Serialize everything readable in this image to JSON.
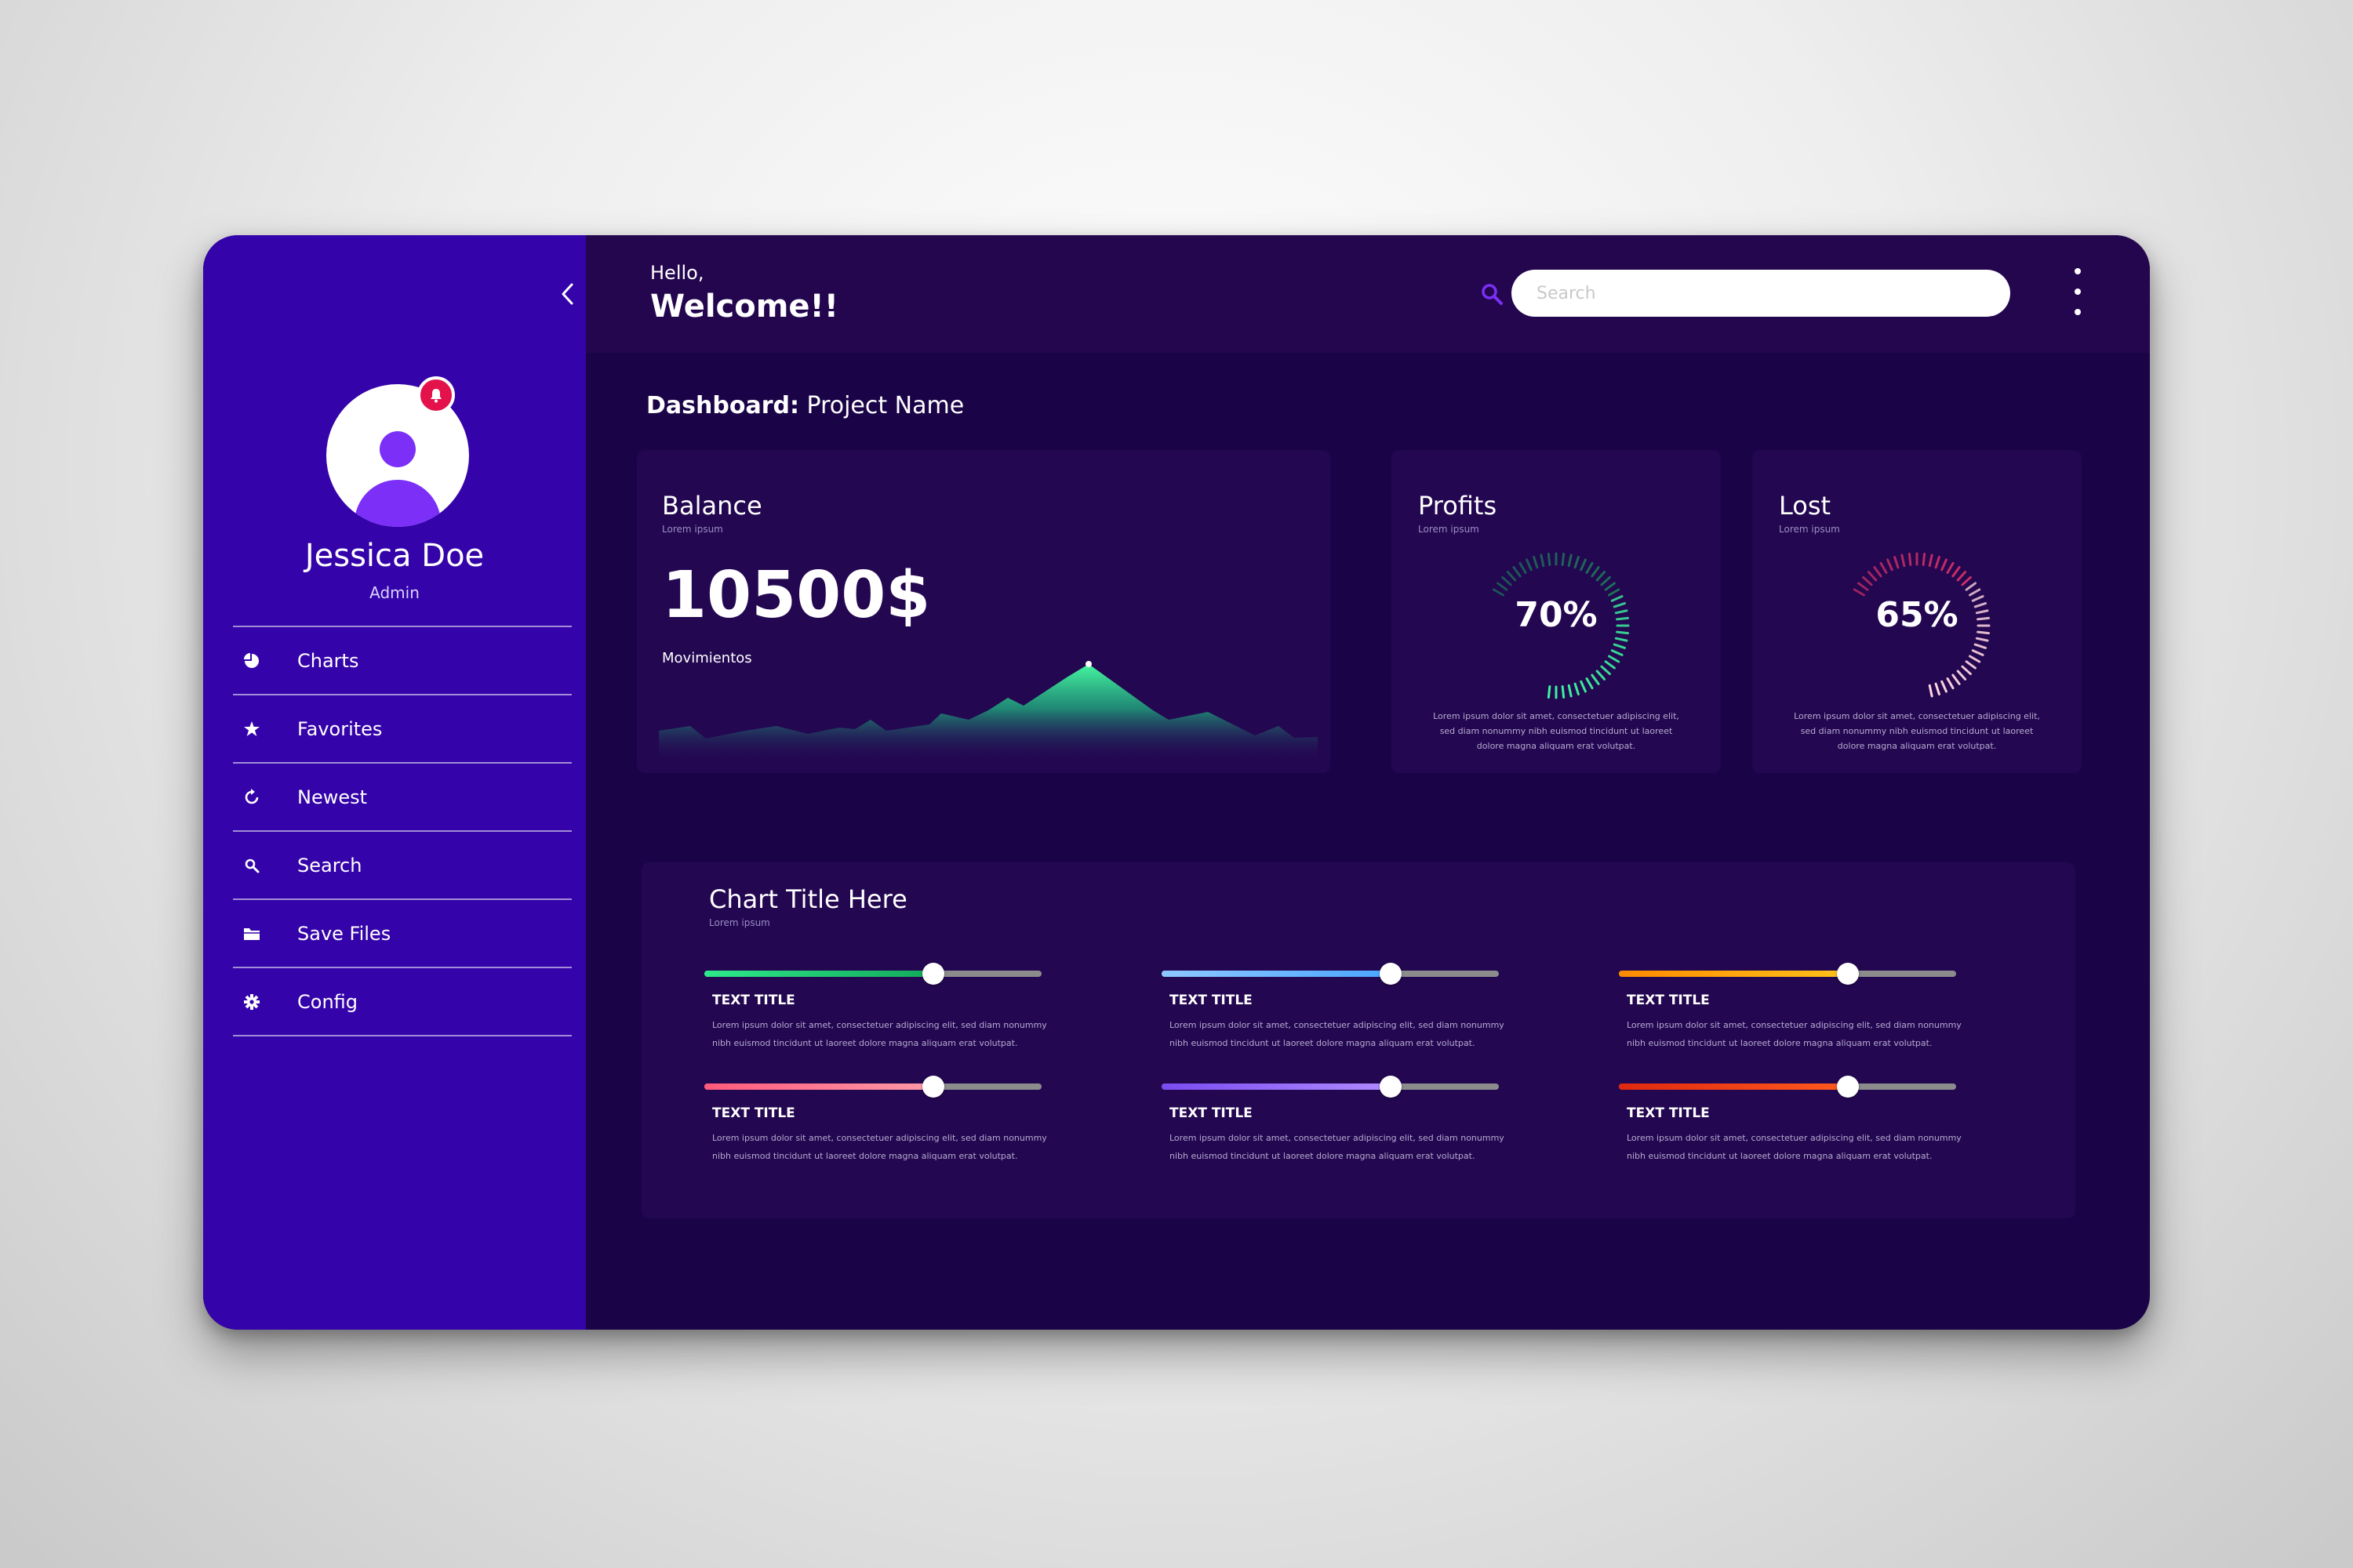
{
  "sidebar": {
    "user": {
      "name": "Jessica Doe",
      "role": "Admin"
    },
    "items": [
      {
        "label": "Charts",
        "icon": "pie-chart-icon"
      },
      {
        "label": "Favorites",
        "icon": "star-icon"
      },
      {
        "label": "Newest",
        "icon": "refresh-icon"
      },
      {
        "label": "Search",
        "icon": "search-icon"
      },
      {
        "label": "Save Files",
        "icon": "folder-icon"
      },
      {
        "label": "Config",
        "icon": "gear-icon"
      }
    ]
  },
  "header": {
    "hello": "Hello,",
    "welcome": "Welcome!!",
    "search_placeholder": "Search"
  },
  "main": {
    "title_bold": "Dashboard:",
    "title_rest": " Project Name",
    "balance": {
      "title": "Balance",
      "subtitle": "Lorem ipsum",
      "value": "10500$",
      "chart_label": "Movimientos"
    },
    "profits": {
      "title": "Profits",
      "subtitle": "Lorem ipsum",
      "value": "70%",
      "percent": 70,
      "text": "Lorem ipsum dolor sit amet, consectetuer adipiscing elit, sed diam nonummy nibh euismod tincidunt ut laoreet dolore magna aliquam erat volutpat."
    },
    "lost": {
      "title": "Lost",
      "subtitle": "Lorem ipsum",
      "value": "65%",
      "percent": 65,
      "text": "Lorem ipsum dolor sit amet, consectetuer adipiscing elit, sed diam nonummy nibh euismod tincidunt ut laoreet dolore magna aliquam erat volutpat."
    },
    "chart_section": {
      "title": "Chart Title Here",
      "subtitle": "Lorem ipsum",
      "items": [
        {
          "title": "TEXT TITLE",
          "text": "Lorem ipsum dolor sit amet, consectetuer adipiscing elit, sed diam nonummy nibh euismod tincidunt ut laoreet dolore magna aliquam erat volutpat.",
          "value": 0.68,
          "color": "#2ee88a",
          "color2": "#13a95b"
        },
        {
          "title": "TEXT TITLE",
          "text": "Lorem ipsum dolor sit amet, consectetuer adipiscing elit, sed diam nonummy nibh euismod tincidunt ut laoreet dolore magna aliquam erat volutpat.",
          "value": 0.68,
          "color": "#8fc8ff",
          "color2": "#4aa5ff"
        },
        {
          "title": "TEXT TITLE",
          "text": "Lorem ipsum dolor sit amet, consectetuer adipiscing elit, sed diam nonummy nibh euismod tincidunt ut laoreet dolore magna aliquam erat volutpat.",
          "value": 0.68,
          "color": "#ff8a00",
          "color2": "#ffc21a"
        },
        {
          "title": "TEXT TITLE",
          "text": "Lorem ipsum dolor sit amet, consectetuer adipiscing elit, sed diam nonummy nibh euismod tincidunt ut laoreet dolore magna aliquam erat volutpat.",
          "value": 0.68,
          "color": "#ff5a7a",
          "color2": "#ff9aa8"
        },
        {
          "title": "TEXT TITLE",
          "text": "Lorem ipsum dolor sit amet, consectetuer adipiscing elit, sed diam nonummy nibh euismod tincidunt ut laoreet dolore magna aliquam erat volutpat.",
          "value": 0.68,
          "color": "#7a4cf0",
          "color2": "#b08bff"
        },
        {
          "title": "TEXT TITLE",
          "text": "Lorem ipsum dolor sit amet, consectetuer adipiscing elit, sed diam nonummy nibh euismod tincidunt ut laoreet dolore magna aliquam erat volutpat.",
          "value": 0.68,
          "color": "#e02810",
          "color2": "#ff5a1e"
        }
      ]
    }
  },
  "colors": {
    "sidebar": "#3403a9",
    "header": "#24064f",
    "background": "#1a0447",
    "card": "#230751",
    "accent_green": "#3df59d",
    "accent_red": "#ff3b6b",
    "notification": "#e3124a"
  }
}
